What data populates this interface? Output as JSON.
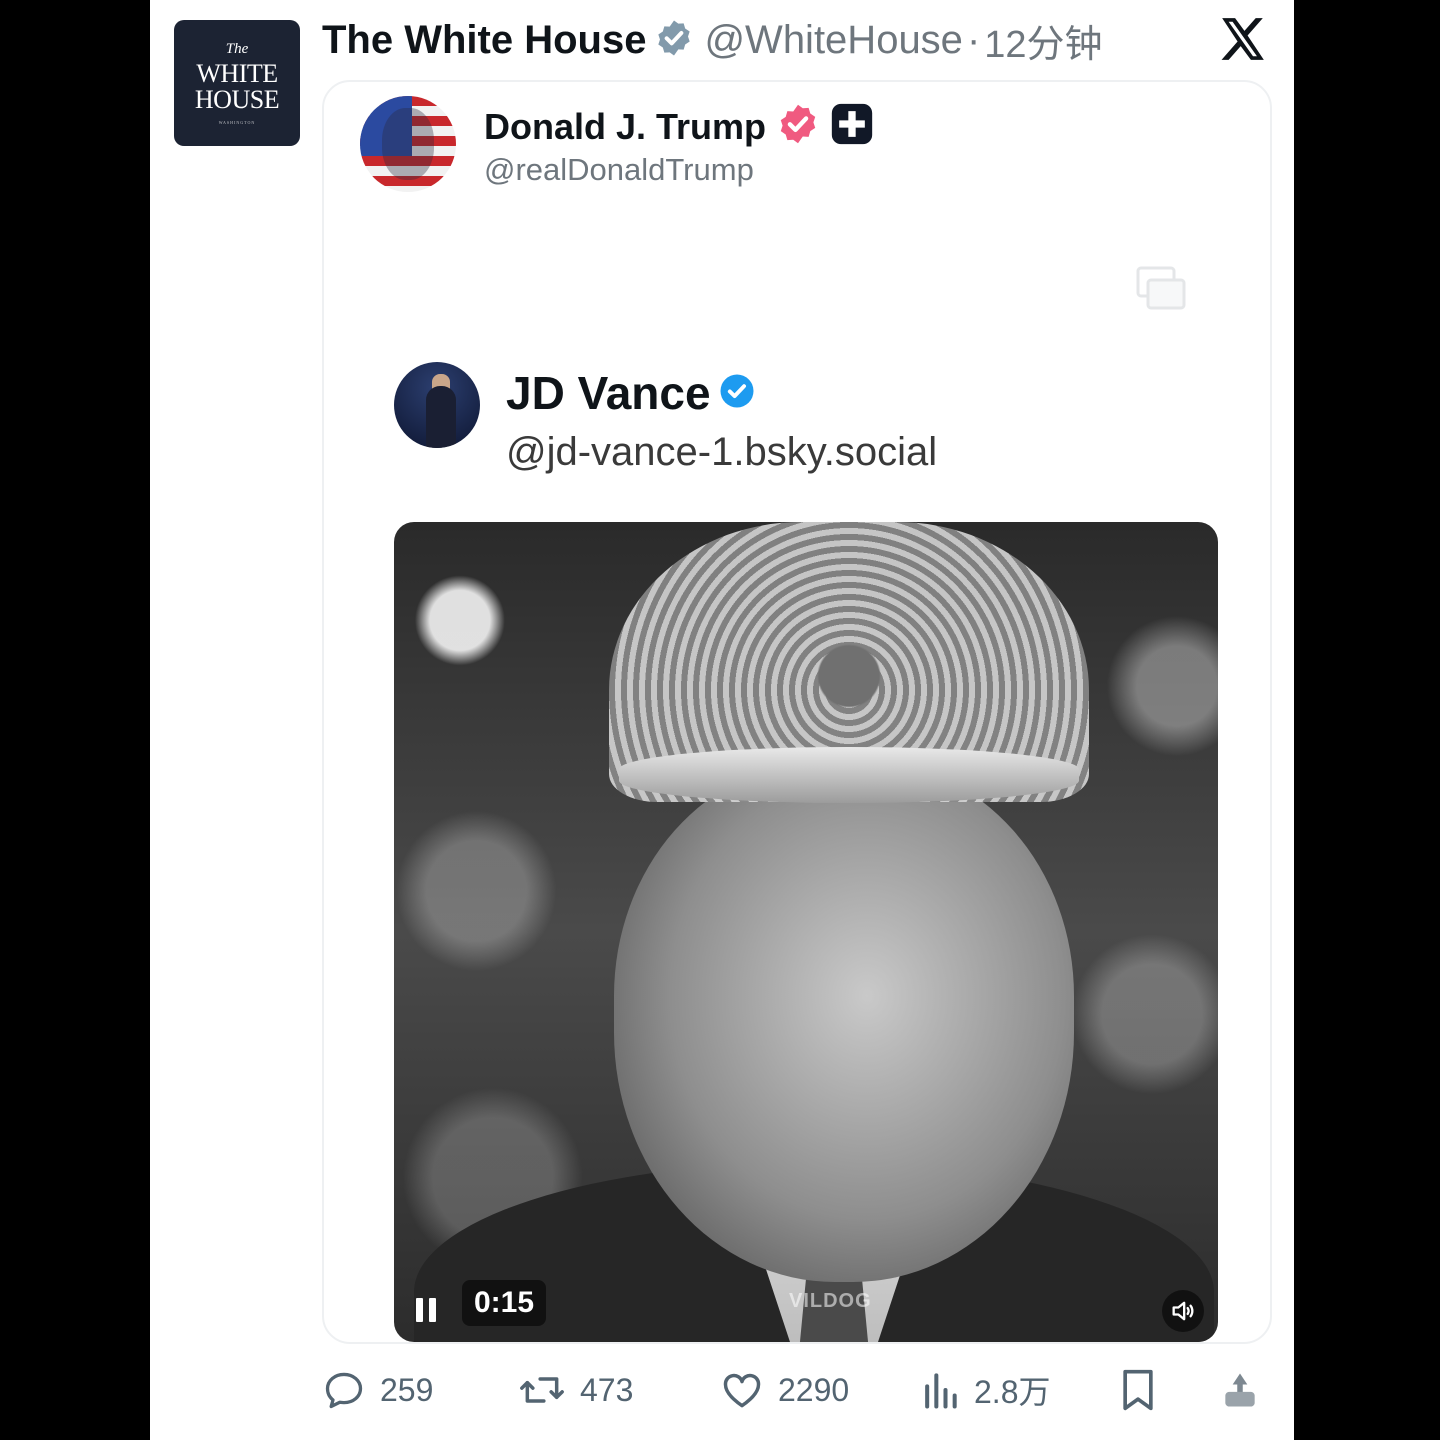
{
  "tweet": {
    "author_name": "The White House",
    "author_handle": "@WhiteHouse",
    "separator": "·",
    "time": "12分钟",
    "avatar": {
      "line1": "The",
      "line2": "WHITE",
      "line3": "HOUSE",
      "line4": "WASHINGTON"
    },
    "verified_badge": "gray-verified-icon",
    "platform_logo": "x-logo-icon"
  },
  "quote": {
    "author_name": "Donald J. Trump",
    "author_handle": "@realDonaldTrump",
    "badges": [
      "red-verified-icon",
      "truth-social-plus-icon"
    ],
    "nested": {
      "author_name": "JD Vance",
      "author_handle": "@jd-vance-1.bsky.social",
      "verified_badge": "blue-verified-icon",
      "video": {
        "timecode": "0:15",
        "watermark": "VILDOG",
        "state": "playing"
      }
    }
  },
  "actions": {
    "replies": "259",
    "reposts": "473",
    "likes": "2290",
    "views": "2.8万"
  },
  "colors": {
    "text_primary": "#0f1419",
    "text_secondary": "#6e767d",
    "verified_blue": "#1d9bf0",
    "verified_pink": "#f05a80",
    "avatar_navy": "#1c2333"
  }
}
